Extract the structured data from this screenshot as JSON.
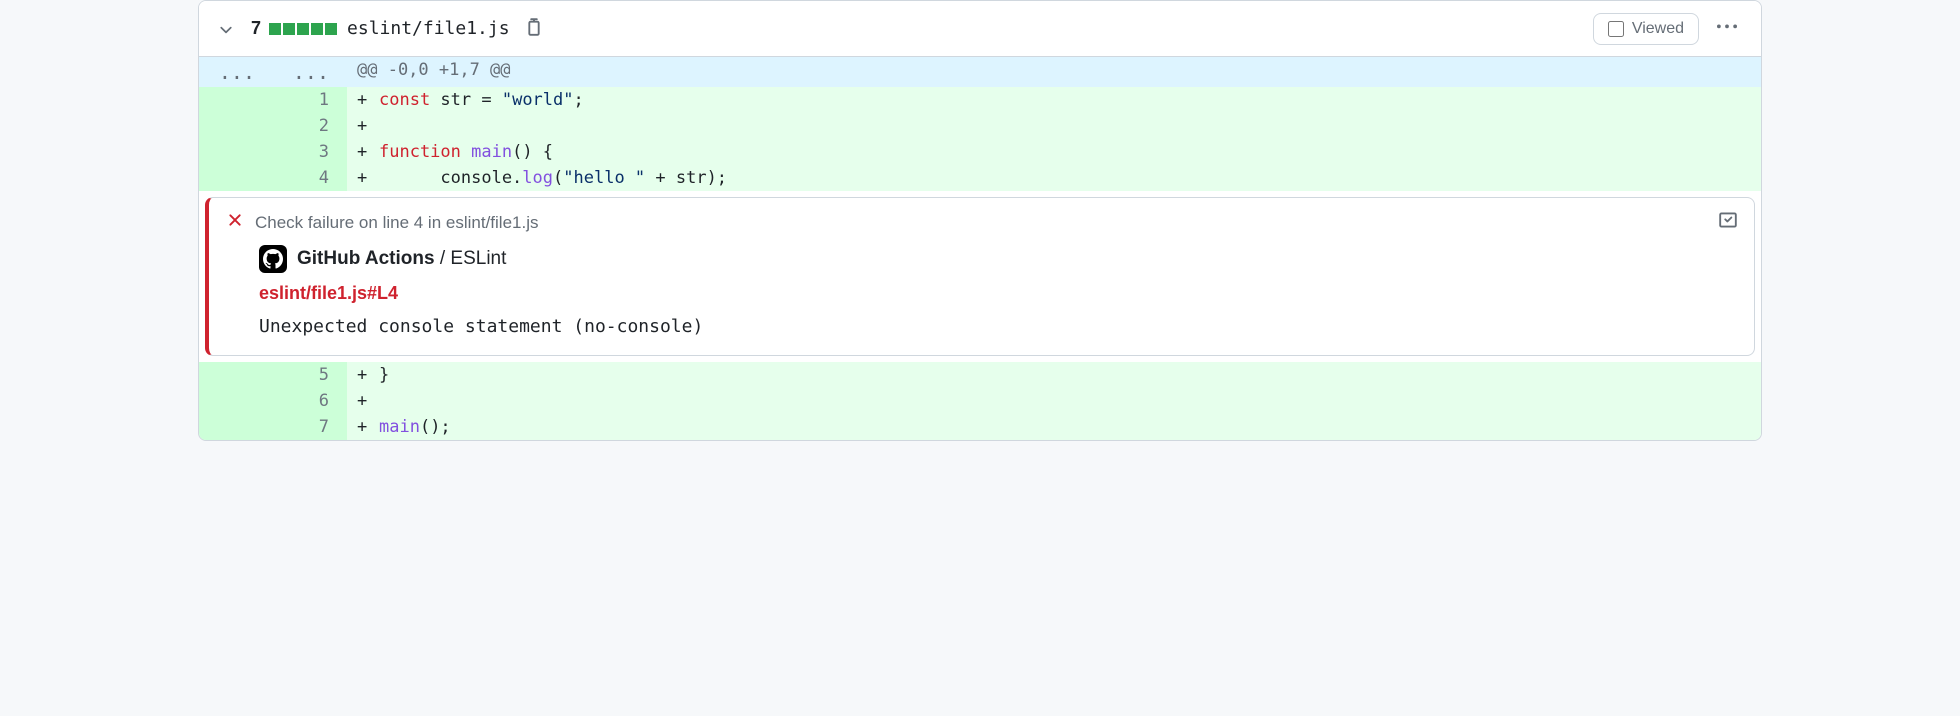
{
  "header": {
    "changes": "7",
    "diffstat_blocks": 5,
    "filepath": "eslint/file1.js",
    "viewed_label": "Viewed"
  },
  "hunk": {
    "left_dots": "...",
    "right_dots": "...",
    "text": "@@ -0,0 +1,7 @@"
  },
  "lines": [
    {
      "n": "1",
      "tokens": [
        {
          "t": "const ",
          "c": "kw"
        },
        {
          "t": "str",
          "c": ""
        },
        {
          "t": " = ",
          "c": ""
        },
        {
          "t": "\"world\"",
          "c": "str"
        },
        {
          "t": ";",
          "c": ""
        }
      ]
    },
    {
      "n": "2",
      "tokens": []
    },
    {
      "n": "3",
      "tokens": [
        {
          "t": "function ",
          "c": "kw"
        },
        {
          "t": "main",
          "c": "fn"
        },
        {
          "t": "() {",
          "c": ""
        }
      ]
    },
    {
      "n": "4",
      "tokens": [
        {
          "t": "      console.",
          "c": ""
        },
        {
          "t": "log",
          "c": "fn"
        },
        {
          "t": "(",
          "c": ""
        },
        {
          "t": "\"hello \"",
          "c": "str"
        },
        {
          "t": " + str);",
          "c": ""
        }
      ]
    },
    {
      "n": "5",
      "tokens": [
        {
          "t": "}",
          "c": ""
        }
      ]
    },
    {
      "n": "6",
      "tokens": []
    },
    {
      "n": "7",
      "tokens": [
        {
          "t": "main",
          "c": "fn"
        },
        {
          "t": "();",
          "c": ""
        }
      ]
    }
  ],
  "annotation": {
    "after_line": "4",
    "title": "Check failure on line 4 in eslint/file1.js",
    "source_strong": "GitHub Actions",
    "source_sep": " / ",
    "source_rest": "ESLint",
    "link": "eslint/file1.js#L4",
    "message": "Unexpected console statement (no-console)"
  }
}
